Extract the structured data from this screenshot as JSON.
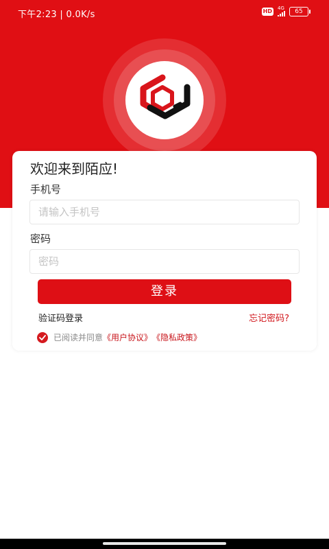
{
  "status_bar": {
    "time_speed": "下午2:23 | 0.0K/s",
    "hd": "HD",
    "network": "4G",
    "battery": "65"
  },
  "app": {
    "welcome": "欢迎来到陌应!",
    "brand_color": "#e00f14"
  },
  "form": {
    "phone_label": "手机号",
    "phone_placeholder": "请输入手机号",
    "password_label": "密码",
    "password_placeholder": "密码",
    "login_button": "登录",
    "sms_login": "验证码登录",
    "forgot_password": "忘记密码?"
  },
  "agreement": {
    "checked": true,
    "prefix": "已阅读并同意",
    "user_agreement": "《用户协议》",
    "privacy_policy": "《隐私政策》"
  },
  "icons": [
    "app-logo",
    "checkmark-icon",
    "signal-icon",
    "battery-icon"
  ]
}
